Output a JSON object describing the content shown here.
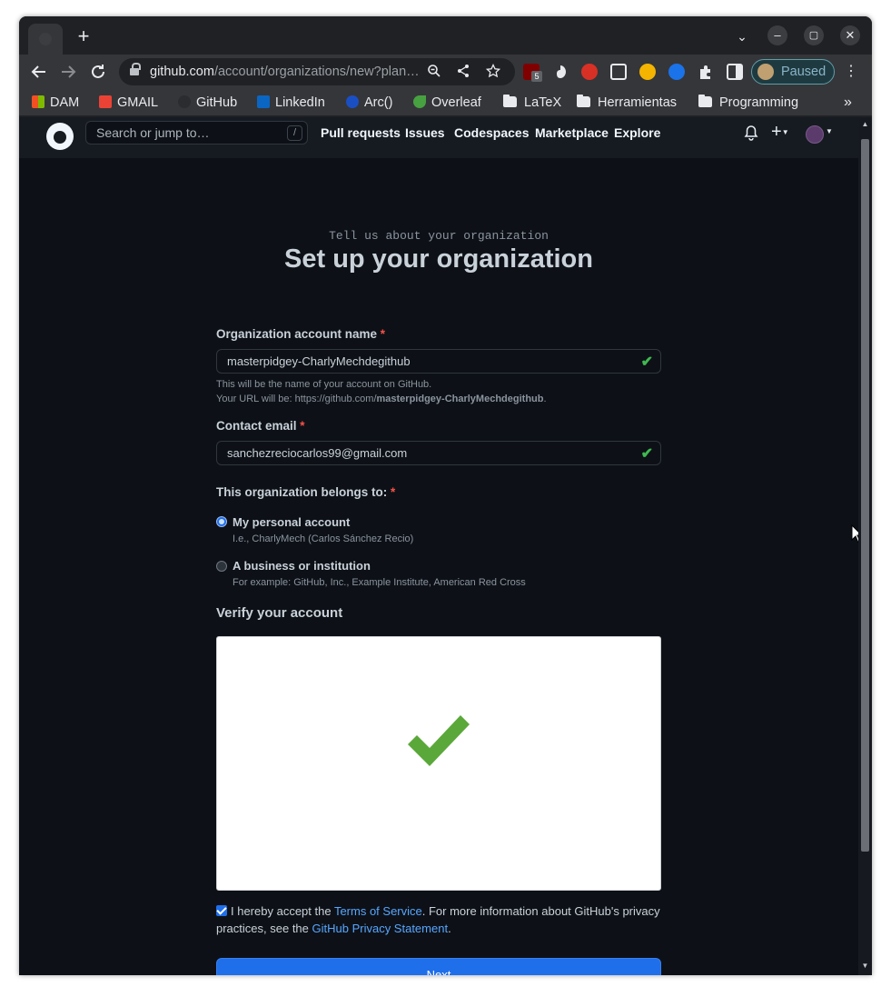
{
  "browser": {
    "new_tab_symbol": "+",
    "tab_search_symbol": "⌄",
    "window_controls": [
      "–",
      "▢",
      "✕"
    ],
    "url_host": "github.com",
    "url_path": "/account/organizations/new?plan…",
    "ublock_badge": "5",
    "profile_status": "Paused",
    "bookmarks": [
      "DAM",
      "GMAIL",
      "GitHub",
      "LinkedIn",
      "Arc()",
      "Overleaf",
      "LaTeX",
      "Herramientas",
      "Programming"
    ],
    "bookmarks_more": "»"
  },
  "github_header": {
    "search_placeholder": "Search or jump to…",
    "search_shortcut": "/",
    "nav": [
      "Pull requests",
      "Issues",
      "Codespaces",
      "Marketplace",
      "Explore"
    ],
    "plus": "+"
  },
  "form": {
    "subtitle": "Tell us about your organization",
    "title": "Set up your organization",
    "org_name_label": "Organization account name",
    "required_mark": "*",
    "org_name_value": "masterpidgey-CharlyMechdegithub",
    "org_name_note_1": "This will be the name of your account on GitHub.",
    "org_name_note_2_prefix": "Your URL will be: https://github.com/",
    "org_name_note_2_bold": "masterpidgey-CharlyMechdegithub",
    "org_name_note_2_suffix": ".",
    "email_label": "Contact email",
    "email_value": "sanchezreciocarlos99@gmail.com",
    "belongs_label": "This organization belongs to:",
    "option_personal_label": "My personal account",
    "option_personal_desc": "I.e., CharlyMech (Carlos Sánchez Recio)",
    "option_business_label": "A business or institution",
    "option_business_desc": "For example: GitHub, Inc., Example Institute, American Red Cross",
    "selected_option": "personal",
    "verify_title": "Verify your account",
    "captcha_state": "verified",
    "terms_prefix": "I hereby accept the ",
    "terms_link": "Terms of Service",
    "terms_middle": ". For more information about GitHub's privacy practices, see the ",
    "privacy_link": "GitHub Privacy Statement",
    "terms_suffix": ".",
    "terms_checked": true,
    "next_label": "Next"
  },
  "colors": {
    "page_bg": "#0d1117",
    "header_bg": "#161b22",
    "accent_blue": "#1f6feb",
    "link_blue": "#58a6ff",
    "success_green": "#3fb950",
    "required_red": "#f85149"
  }
}
